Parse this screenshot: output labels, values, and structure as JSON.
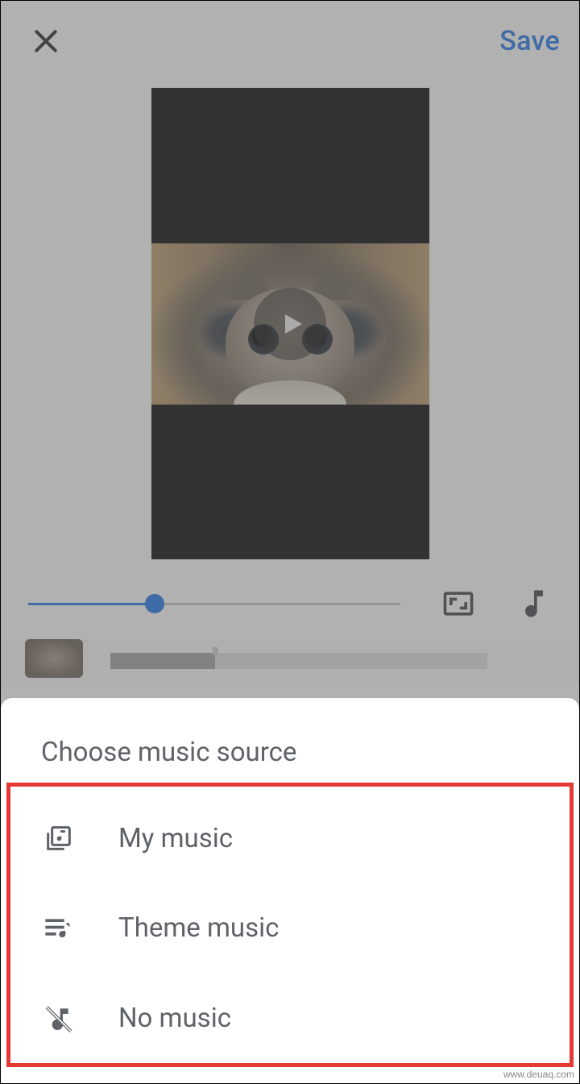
{
  "header": {
    "save_label": "Save"
  },
  "player": {
    "progress_percent": 34
  },
  "sheet": {
    "title": "Choose music source",
    "options": [
      {
        "label": "My music"
      },
      {
        "label": "Theme music"
      },
      {
        "label": "No music"
      }
    ]
  },
  "watermark": "www.deuaq.com"
}
